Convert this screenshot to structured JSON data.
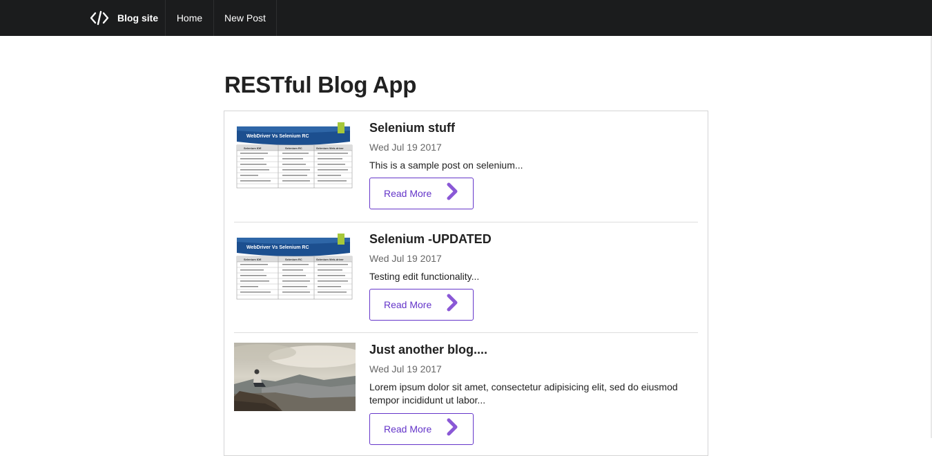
{
  "colors": {
    "nav_bg": "#1b1c1d",
    "accent": "#6435c9",
    "accent_icon": "#8a58d6"
  },
  "nav": {
    "brand_icon": "code-icon",
    "brand": "Blog site",
    "items": [
      {
        "label": "Home"
      },
      {
        "label": "New Post"
      }
    ]
  },
  "page": {
    "title": "RESTful Blog App"
  },
  "posts": [
    {
      "title": "Selenium stuff",
      "date": "Wed Jul 19 2017",
      "excerpt": "This is a sample post on selenium...",
      "read_more": "Read More",
      "image": {
        "banner": "WebDriver Vs Selenium RC",
        "columns": [
          "Selenium IDE",
          "Selenium RC",
          "Selenium Web-driver"
        ]
      }
    },
    {
      "title": "Selenium -UPDATED",
      "date": "Wed Jul 19 2017",
      "excerpt": "Testing edit functionality...",
      "read_more": "Read More",
      "image": {
        "banner": "WebDriver Vs Selenium RC",
        "columns": [
          "Selenium IDE",
          "Selenium RC",
          "Selenium Web-driver"
        ]
      }
    },
    {
      "title": "Just another blog....",
      "date": "Wed Jul 19 2017",
      "excerpt": "Lorem ipsum dolor sit amet, consectetur adipisicing elit, sed do eiusmod tempor incididunt ut labor...",
      "read_more": "Read More",
      "image": {
        "subject": "person-on-cliff-photo"
      }
    }
  ]
}
